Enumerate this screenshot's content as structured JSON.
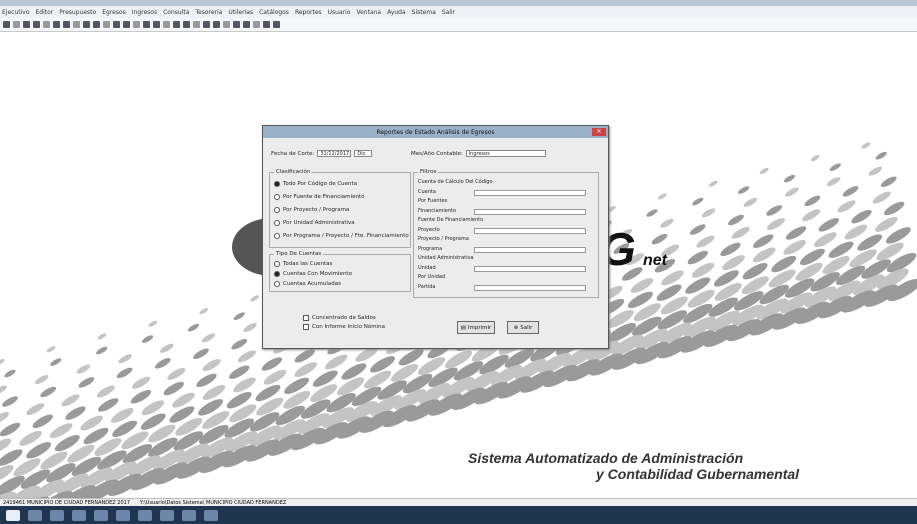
{
  "menubar": {
    "items": [
      "Ejecutivo",
      "Editor",
      "Presupuesto",
      "Egresos",
      "Ingresos",
      "Consulta",
      "Tesorería",
      "Utilerías",
      "Catálogos",
      "Reportes",
      "Usuario",
      "Ventana",
      "Ayuda",
      "Sistema",
      "Salir"
    ]
  },
  "dialog": {
    "title": "Reportes de Estado Análisis de Egresos",
    "fecha_label": "Fecha de Corte:",
    "fecha_value": "31/12/2017",
    "mes_value": "Dic",
    "mes_label": "Mes/Año Contable:",
    "mes_contable_value": "Ingresos",
    "clasificacion_title": "Clasificación",
    "clasificacion_options": [
      "Todo Por Código de Cuenta",
      "Por Fuente de Financiamiento",
      "Por Proyecto / Programa",
      "Por Unidad Administrativa",
      "Por Programa / Proyecto / Fte. Financiamiento"
    ],
    "tipo_title": "Tipo De Cuentas",
    "tipo_options": [
      "Todas las Cuentas",
      "Cuentas Con Movimiento",
      "Cuentas Acumuladas"
    ],
    "filtros_title": "Filtros",
    "filtros": [
      "Cuenta de Cálculo Del Código",
      "Cuenta",
      "Por Fuentes",
      "Financiamiento",
      "Fuente De Financiamiento",
      "Proyecto",
      "Proyecto / Programa",
      "Programa",
      "Unidad Administrativa",
      "Unidad",
      "Por Unidad",
      "Partida"
    ],
    "check_options": [
      "Concentrado de Saldos",
      "Con Informe Inicio Nómina"
    ],
    "imprimir_label": "Imprimir",
    "salir_label": "Salir"
  },
  "branding": {
    "logo_letter": "G",
    "logo_suffix": "net",
    "tagline1": "Sistema Automatizado de Administración",
    "tagline2": "y Contabilidad Gubernamental"
  },
  "status": {
    "entity": "2419461 MUNICIPIO DE CIUDAD FERNANDEZ 2017",
    "path": "Y:\\Usuario\\Datos Sistema\\ MUNICIPIO CIUDAD FERNANDEZ"
  }
}
